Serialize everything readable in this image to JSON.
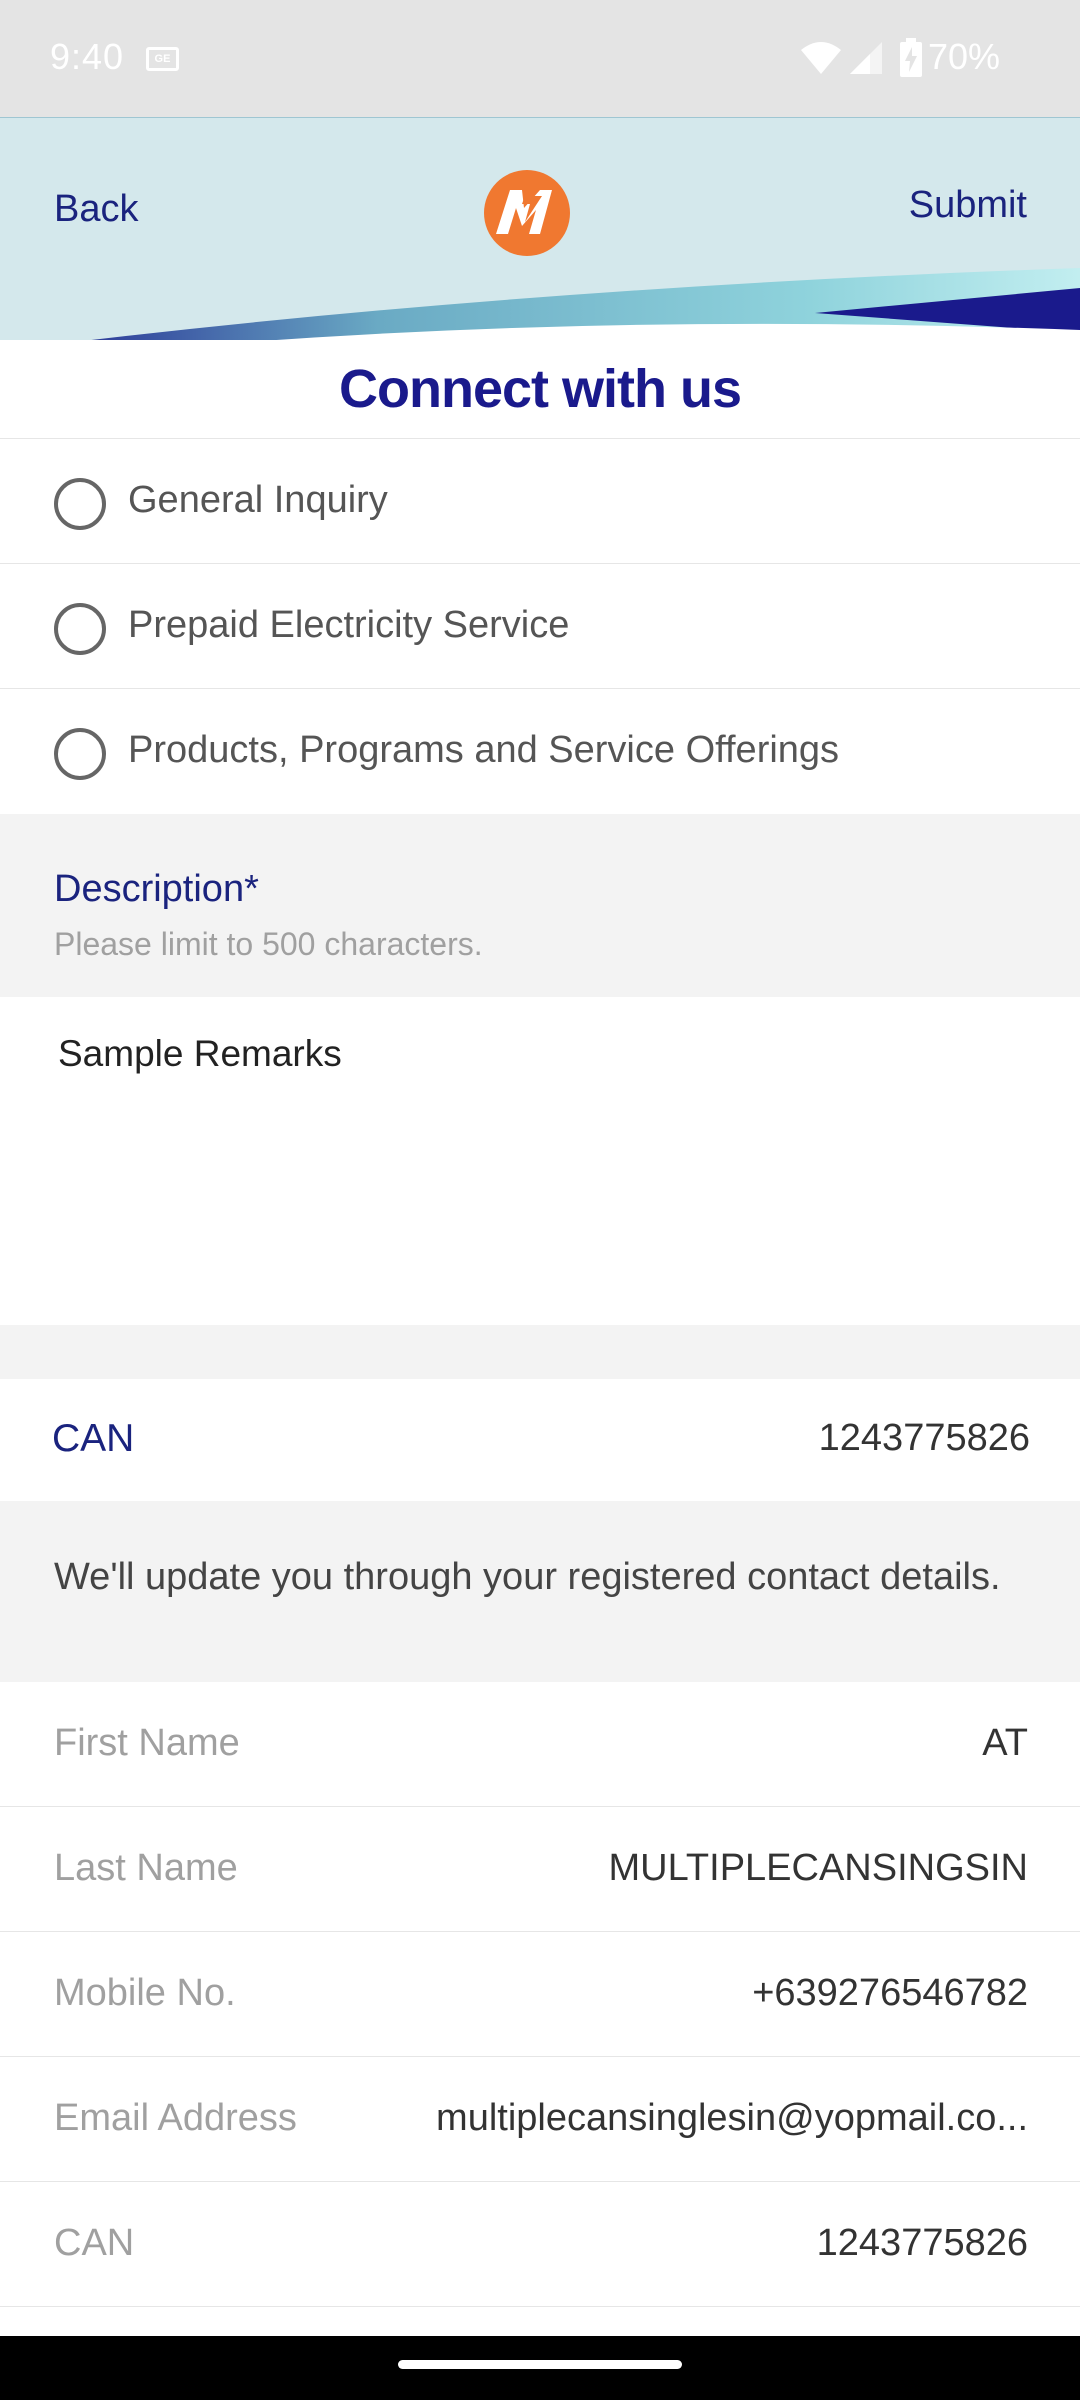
{
  "status_bar": {
    "time": "9:40",
    "sim_label": "GE",
    "battery_percent": "70%",
    "icons": [
      "sim-icon",
      "wifi-icon",
      "signal-icon",
      "battery-charging-icon"
    ]
  },
  "header": {
    "back_label": "Back",
    "submit_label": "Submit",
    "logo": "meralco-logo",
    "title": "Connect with us",
    "colors": {
      "background": "#d4e8ec",
      "accent": "#1a237e",
      "logo": "#f07830"
    }
  },
  "inquiry_types": [
    {
      "label": "General Inquiry",
      "selected": false
    },
    {
      "label": "Prepaid Electricity Service",
      "selected": false
    },
    {
      "label": "Products, Programs and Service Offerings",
      "selected": false
    }
  ],
  "description": {
    "label": "Description*",
    "hint": "Please limit to 500 characters.",
    "value": "Sample Remarks"
  },
  "can_field": {
    "label": "CAN",
    "value": "1243775826"
  },
  "notice": "We'll update you through your registered contact details.",
  "contact": [
    {
      "label": "First Name",
      "value": "AT"
    },
    {
      "label": "Last Name",
      "value": "MULTIPLECANSINGSIN"
    },
    {
      "label": "Mobile No.",
      "value": "+639276546782"
    },
    {
      "label": "Email Address",
      "value": "multiplecansinglesin@yopmail.co..."
    },
    {
      "label": "CAN",
      "value": "1243775826"
    }
  ]
}
